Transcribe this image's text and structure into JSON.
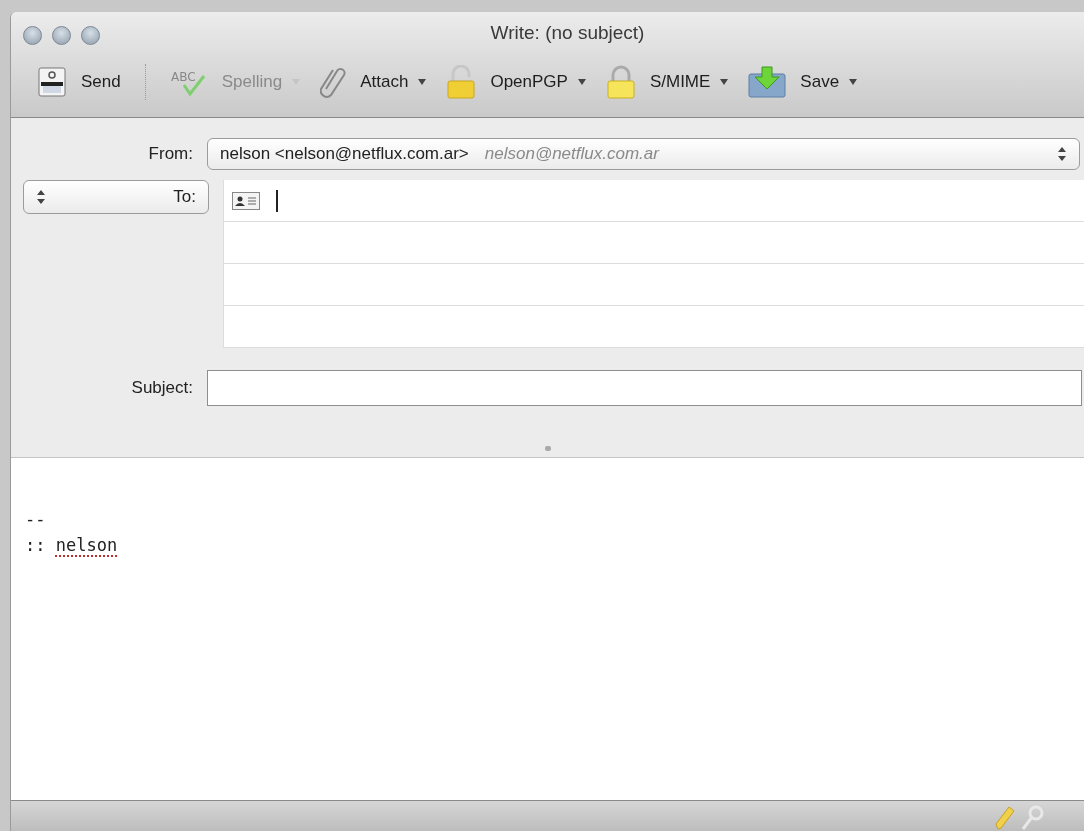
{
  "window": {
    "title": "Write: (no subject)"
  },
  "toolbar": [
    {
      "kind": "send",
      "label": "Send",
      "disabled": false,
      "has_menu": false
    },
    {
      "kind": "spelling",
      "label": "Spelling",
      "icon_text": "ABC",
      "disabled": true,
      "has_menu": true
    },
    {
      "kind": "attach",
      "label": "Attach",
      "disabled": false,
      "has_menu": true
    },
    {
      "kind": "openpgp",
      "label": "OpenPGP",
      "disabled": false,
      "has_menu": true
    },
    {
      "kind": "smime",
      "label": "S/MIME",
      "disabled": false,
      "has_menu": true
    },
    {
      "kind": "save",
      "label": "Save",
      "disabled": false,
      "has_menu": true
    }
  ],
  "from": {
    "label": "From:",
    "value": "nelson <nelson@netflux.com.ar>",
    "hint": "nelson@netflux.com.ar"
  },
  "to": {
    "label": "To:",
    "rows": [
      {
        "focused": true
      },
      {
        "focused": false
      },
      {
        "focused": false
      },
      {
        "focused": false
      }
    ]
  },
  "subject": {
    "label": "Subject:"
  },
  "body": [
    [
      {
        "text": "--",
        "misspelled": false
      }
    ],
    [
      {
        "text": ":: ",
        "misspelled": false
      },
      {
        "text": "nelson",
        "misspelled": true
      }
    ]
  ]
}
